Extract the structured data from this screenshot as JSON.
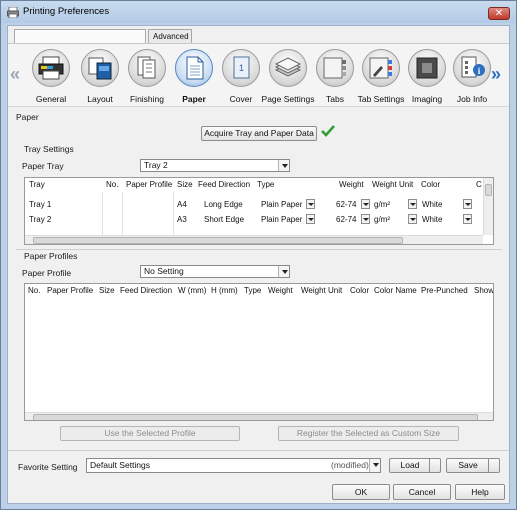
{
  "window": {
    "title": "Printing Preferences",
    "close_glyph": "✕"
  },
  "tabs": {
    "advanced": "Advanced"
  },
  "toolbar": {
    "items": [
      {
        "label": "General",
        "icon": "printer-icon"
      },
      {
        "label": "Layout",
        "icon": "layout-icon"
      },
      {
        "label": "Finishing",
        "icon": "finishing-icon"
      },
      {
        "label": "Paper",
        "icon": "paper-icon",
        "active": true
      },
      {
        "label": "Cover",
        "icon": "cover-icon"
      },
      {
        "label": "Page Settings",
        "icon": "page-settings-icon"
      },
      {
        "label": "Tabs",
        "icon": "tabs-icon"
      },
      {
        "label": "Tab Settings",
        "icon": "tab-settings-icon"
      },
      {
        "label": "Imaging",
        "icon": "imaging-icon"
      },
      {
        "label": "Job Info",
        "icon": "job-info-icon"
      }
    ],
    "left_chevron": "«",
    "right_chevron": "»"
  },
  "paper": {
    "section_title": "Paper",
    "acquire_button": "Acquire Tray and Paper Data",
    "tray_settings_title": "Tray Settings",
    "paper_tray_label": "Paper Tray",
    "paper_tray_value": "Tray 2",
    "tray_columns": [
      "Tray",
      "No.",
      "Paper Profile",
      "Size",
      "Feed Direction",
      "Type",
      "Weight",
      "Weight Unit",
      "Color",
      "C"
    ],
    "tray_rows": [
      {
        "tray": "Tray 1",
        "no": "",
        "profile": "",
        "size": "A4",
        "feed": "Long Edge",
        "type": "Plain Paper",
        "weight": "62-74",
        "unit": "g/m²",
        "color": "White"
      },
      {
        "tray": "Tray 2",
        "no": "",
        "profile": "",
        "size": "A3",
        "feed": "Short Edge",
        "type": "Plain Paper",
        "weight": "62-74",
        "unit": "g/m²",
        "color": "White"
      }
    ]
  },
  "profiles": {
    "section_title": "Paper Profiles",
    "profile_label": "Paper Profile",
    "profile_value": "No Setting",
    "columns": [
      "No.",
      "Paper Profile",
      "Size",
      "Feed Direction",
      "W (mm)",
      "H (mm)",
      "Type",
      "Weight",
      "Weight Unit",
      "Color",
      "Color Name",
      "Pre-Punched",
      "Show"
    ],
    "use_button": "Use the Selected Profile",
    "register_button": "Register the Selected as Custom Size"
  },
  "favorite": {
    "label": "Favorite Setting",
    "value": "Default Settings",
    "modified": "(modified)",
    "load_button": "Load",
    "save_button": "Save"
  },
  "dialog": {
    "ok": "OK",
    "cancel": "Cancel",
    "help": "Help"
  },
  "colors": {
    "accent": "#2f6fc0",
    "check": "#2e9e2e",
    "title_bg": "#bcd1e8"
  }
}
